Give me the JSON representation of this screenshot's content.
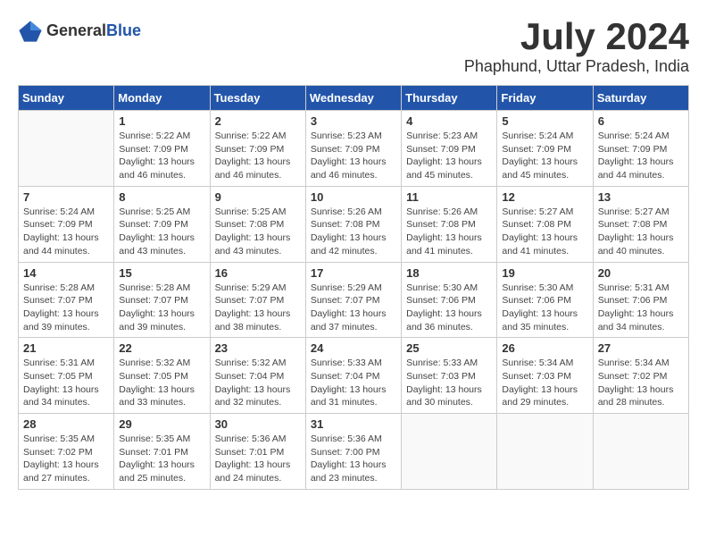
{
  "logo": {
    "text_general": "General",
    "text_blue": "Blue"
  },
  "title": {
    "month_year": "July 2024",
    "location": "Phaphund, Uttar Pradesh, India"
  },
  "weekdays": [
    "Sunday",
    "Monday",
    "Tuesday",
    "Wednesday",
    "Thursday",
    "Friday",
    "Saturday"
  ],
  "weeks": [
    [
      {
        "day": "",
        "sunrise": "",
        "sunset": "",
        "daylight": ""
      },
      {
        "day": "1",
        "sunrise": "Sunrise: 5:22 AM",
        "sunset": "Sunset: 7:09 PM",
        "daylight": "Daylight: 13 hours and 46 minutes."
      },
      {
        "day": "2",
        "sunrise": "Sunrise: 5:22 AM",
        "sunset": "Sunset: 7:09 PM",
        "daylight": "Daylight: 13 hours and 46 minutes."
      },
      {
        "day": "3",
        "sunrise": "Sunrise: 5:23 AM",
        "sunset": "Sunset: 7:09 PM",
        "daylight": "Daylight: 13 hours and 46 minutes."
      },
      {
        "day": "4",
        "sunrise": "Sunrise: 5:23 AM",
        "sunset": "Sunset: 7:09 PM",
        "daylight": "Daylight: 13 hours and 45 minutes."
      },
      {
        "day": "5",
        "sunrise": "Sunrise: 5:24 AM",
        "sunset": "Sunset: 7:09 PM",
        "daylight": "Daylight: 13 hours and 45 minutes."
      },
      {
        "day": "6",
        "sunrise": "Sunrise: 5:24 AM",
        "sunset": "Sunset: 7:09 PM",
        "daylight": "Daylight: 13 hours and 44 minutes."
      }
    ],
    [
      {
        "day": "7",
        "sunrise": "Sunrise: 5:24 AM",
        "sunset": "Sunset: 7:09 PM",
        "daylight": "Daylight: 13 hours and 44 minutes."
      },
      {
        "day": "8",
        "sunrise": "Sunrise: 5:25 AM",
        "sunset": "Sunset: 7:09 PM",
        "daylight": "Daylight: 13 hours and 43 minutes."
      },
      {
        "day": "9",
        "sunrise": "Sunrise: 5:25 AM",
        "sunset": "Sunset: 7:08 PM",
        "daylight": "Daylight: 13 hours and 43 minutes."
      },
      {
        "day": "10",
        "sunrise": "Sunrise: 5:26 AM",
        "sunset": "Sunset: 7:08 PM",
        "daylight": "Daylight: 13 hours and 42 minutes."
      },
      {
        "day": "11",
        "sunrise": "Sunrise: 5:26 AM",
        "sunset": "Sunset: 7:08 PM",
        "daylight": "Daylight: 13 hours and 41 minutes."
      },
      {
        "day": "12",
        "sunrise": "Sunrise: 5:27 AM",
        "sunset": "Sunset: 7:08 PM",
        "daylight": "Daylight: 13 hours and 41 minutes."
      },
      {
        "day": "13",
        "sunrise": "Sunrise: 5:27 AM",
        "sunset": "Sunset: 7:08 PM",
        "daylight": "Daylight: 13 hours and 40 minutes."
      }
    ],
    [
      {
        "day": "14",
        "sunrise": "Sunrise: 5:28 AM",
        "sunset": "Sunset: 7:07 PM",
        "daylight": "Daylight: 13 hours and 39 minutes."
      },
      {
        "day": "15",
        "sunrise": "Sunrise: 5:28 AM",
        "sunset": "Sunset: 7:07 PM",
        "daylight": "Daylight: 13 hours and 39 minutes."
      },
      {
        "day": "16",
        "sunrise": "Sunrise: 5:29 AM",
        "sunset": "Sunset: 7:07 PM",
        "daylight": "Daylight: 13 hours and 38 minutes."
      },
      {
        "day": "17",
        "sunrise": "Sunrise: 5:29 AM",
        "sunset": "Sunset: 7:07 PM",
        "daylight": "Daylight: 13 hours and 37 minutes."
      },
      {
        "day": "18",
        "sunrise": "Sunrise: 5:30 AM",
        "sunset": "Sunset: 7:06 PM",
        "daylight": "Daylight: 13 hours and 36 minutes."
      },
      {
        "day": "19",
        "sunrise": "Sunrise: 5:30 AM",
        "sunset": "Sunset: 7:06 PM",
        "daylight": "Daylight: 13 hours and 35 minutes."
      },
      {
        "day": "20",
        "sunrise": "Sunrise: 5:31 AM",
        "sunset": "Sunset: 7:06 PM",
        "daylight": "Daylight: 13 hours and 34 minutes."
      }
    ],
    [
      {
        "day": "21",
        "sunrise": "Sunrise: 5:31 AM",
        "sunset": "Sunset: 7:05 PM",
        "daylight": "Daylight: 13 hours and 34 minutes."
      },
      {
        "day": "22",
        "sunrise": "Sunrise: 5:32 AM",
        "sunset": "Sunset: 7:05 PM",
        "daylight": "Daylight: 13 hours and 33 minutes."
      },
      {
        "day": "23",
        "sunrise": "Sunrise: 5:32 AM",
        "sunset": "Sunset: 7:04 PM",
        "daylight": "Daylight: 13 hours and 32 minutes."
      },
      {
        "day": "24",
        "sunrise": "Sunrise: 5:33 AM",
        "sunset": "Sunset: 7:04 PM",
        "daylight": "Daylight: 13 hours and 31 minutes."
      },
      {
        "day": "25",
        "sunrise": "Sunrise: 5:33 AM",
        "sunset": "Sunset: 7:03 PM",
        "daylight": "Daylight: 13 hours and 30 minutes."
      },
      {
        "day": "26",
        "sunrise": "Sunrise: 5:34 AM",
        "sunset": "Sunset: 7:03 PM",
        "daylight": "Daylight: 13 hours and 29 minutes."
      },
      {
        "day": "27",
        "sunrise": "Sunrise: 5:34 AM",
        "sunset": "Sunset: 7:02 PM",
        "daylight": "Daylight: 13 hours and 28 minutes."
      }
    ],
    [
      {
        "day": "28",
        "sunrise": "Sunrise: 5:35 AM",
        "sunset": "Sunset: 7:02 PM",
        "daylight": "Daylight: 13 hours and 27 minutes."
      },
      {
        "day": "29",
        "sunrise": "Sunrise: 5:35 AM",
        "sunset": "Sunset: 7:01 PM",
        "daylight": "Daylight: 13 hours and 25 minutes."
      },
      {
        "day": "30",
        "sunrise": "Sunrise: 5:36 AM",
        "sunset": "Sunset: 7:01 PM",
        "daylight": "Daylight: 13 hours and 24 minutes."
      },
      {
        "day": "31",
        "sunrise": "Sunrise: 5:36 AM",
        "sunset": "Sunset: 7:00 PM",
        "daylight": "Daylight: 13 hours and 23 minutes."
      },
      {
        "day": "",
        "sunrise": "",
        "sunset": "",
        "daylight": ""
      },
      {
        "day": "",
        "sunrise": "",
        "sunset": "",
        "daylight": ""
      },
      {
        "day": "",
        "sunrise": "",
        "sunset": "",
        "daylight": ""
      }
    ]
  ]
}
